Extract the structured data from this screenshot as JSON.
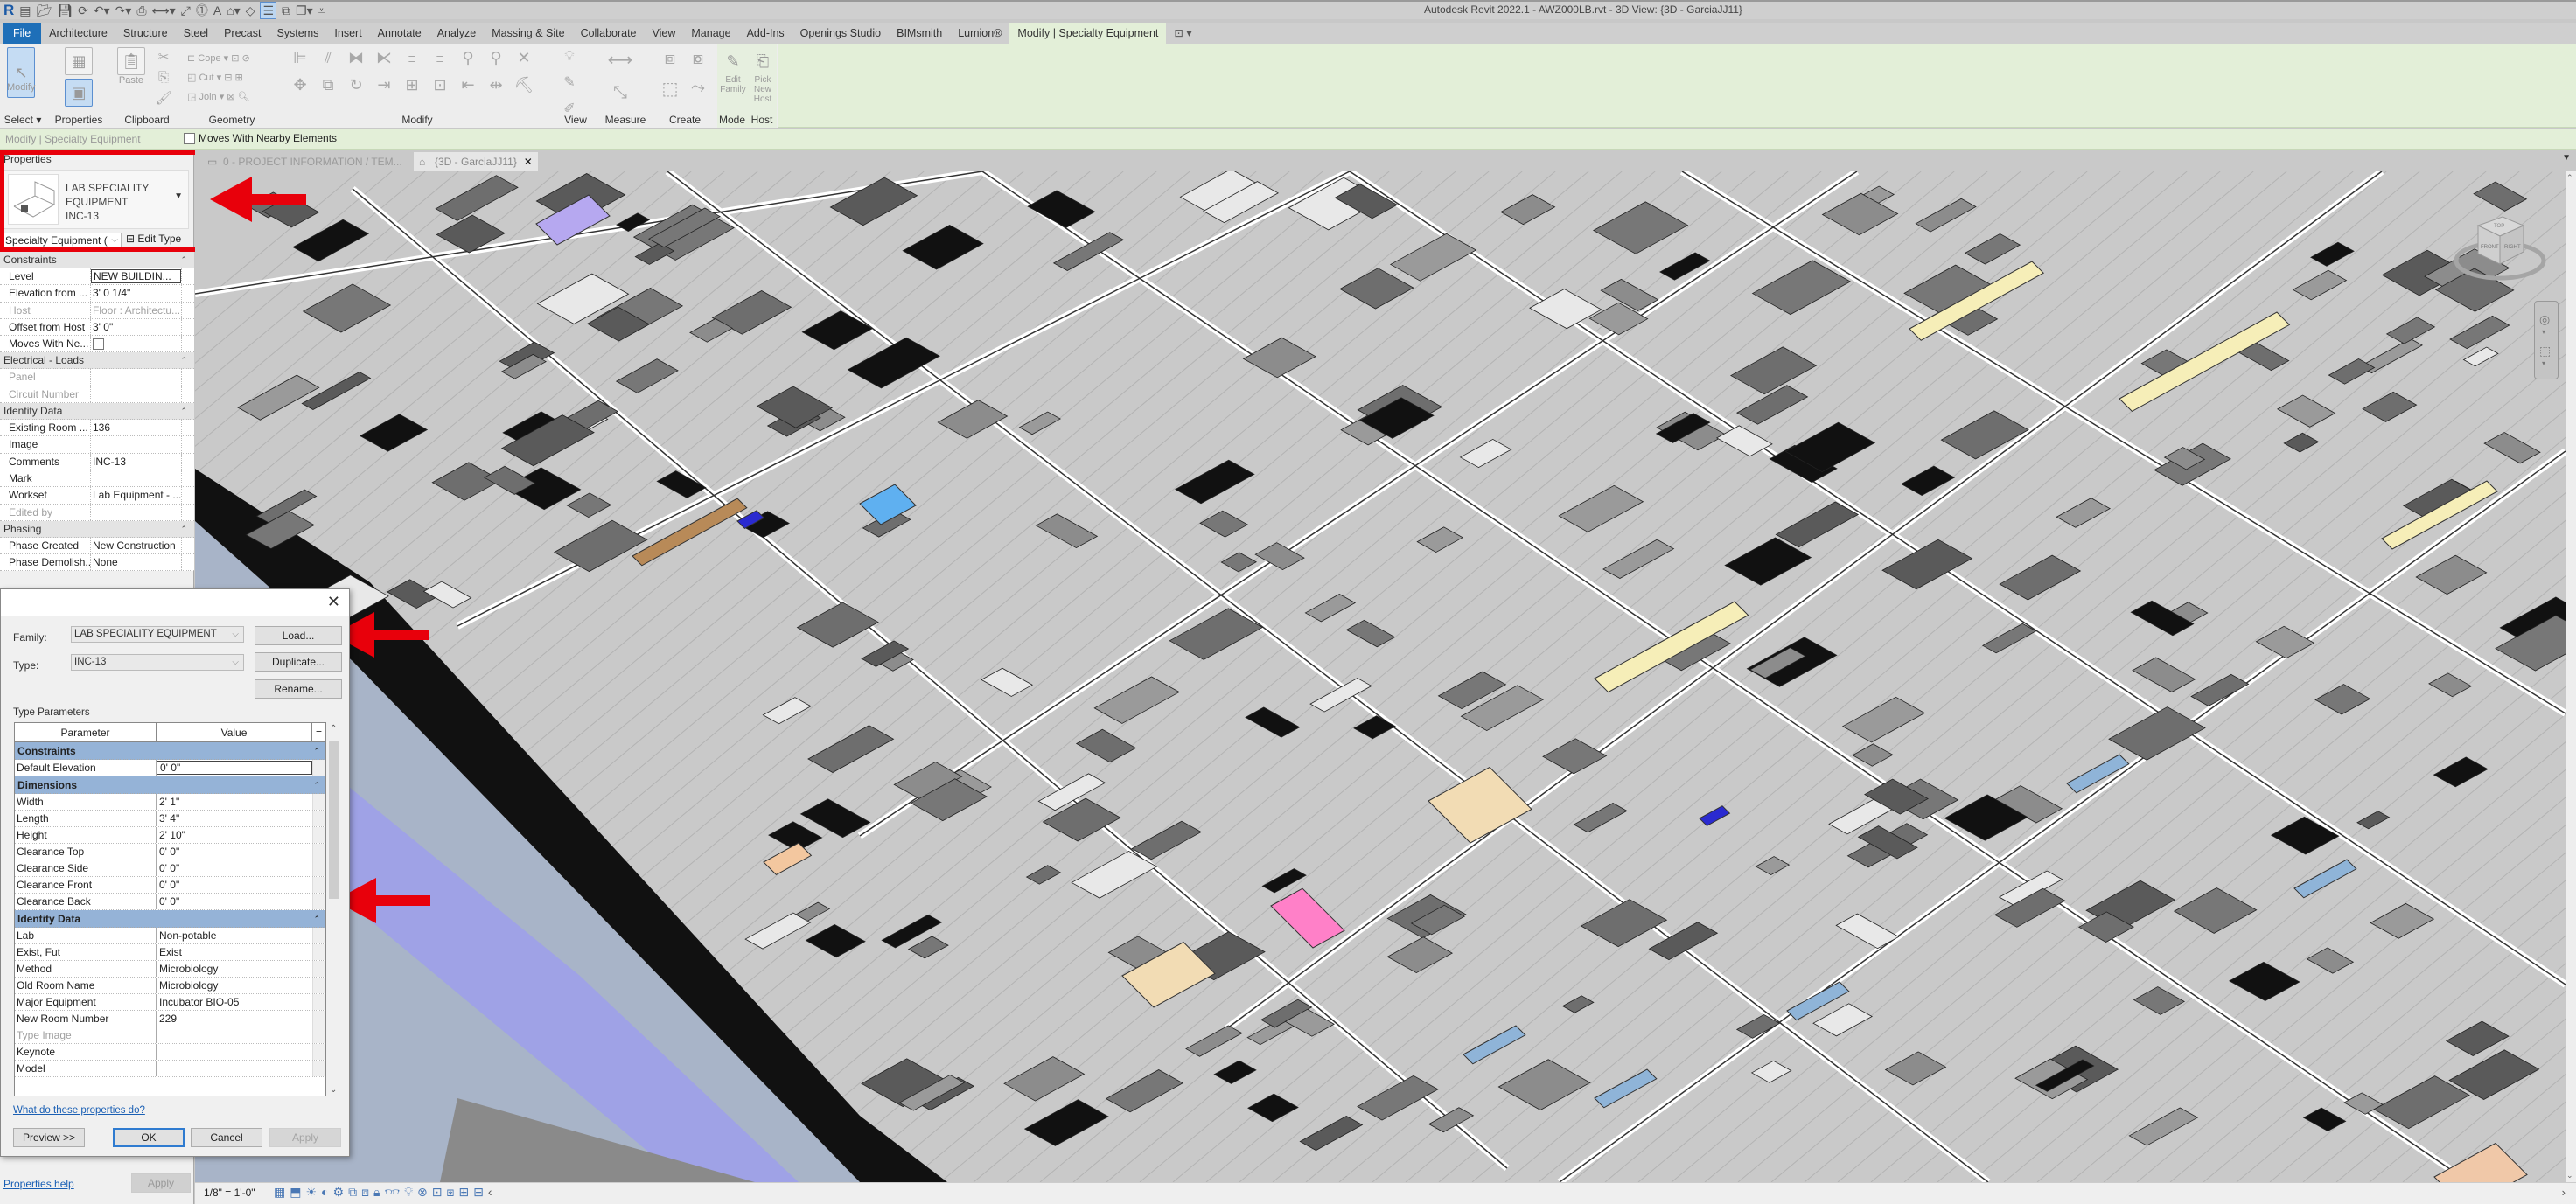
{
  "app": {
    "window_title": "Autodesk Revit 2022.1 - AWZ000LB.rvt - 3D View: {3D - GarciaJJ11}",
    "logo": "R"
  },
  "ribbon": {
    "tabs": [
      "File",
      "Architecture",
      "Structure",
      "Steel",
      "Precast",
      "Systems",
      "Insert",
      "Annotate",
      "Analyze",
      "Massing & Site",
      "Collaborate",
      "View",
      "Manage",
      "Add-Ins",
      "Openings Studio",
      "BIMsmith",
      "Lumion®",
      "Modify | Specialty Equipment"
    ],
    "active_tab": "Modify | Specialty Equipment",
    "panels": [
      "Select ▾",
      "Properties",
      "Clipboard",
      "Geometry",
      "Modify",
      "View",
      "Measure",
      "Create",
      "Mode",
      "Host"
    ],
    "buttons": {
      "modify": "Modify",
      "paste": "Paste",
      "cope": "Cope",
      "cut": "Cut",
      "join": "Join",
      "edit_family": "Edit Family",
      "pick_new_host": "Pick New Host"
    }
  },
  "options_bar": {
    "context": "Modify | Specialty Equipment",
    "moves_with_nearby": {
      "label": "Moves With Nearby Elements",
      "checked": false
    }
  },
  "properties": {
    "title": "Properties",
    "type_name_lines": [
      "LAB SPECIALITY",
      "EQUIPMENT",
      "INC-13"
    ],
    "filter": "Specialty Equipment (",
    "edit_type": "Edit Type",
    "groups": [
      {
        "name": "Constraints",
        "rows": [
          {
            "name": "Level",
            "value": "NEW BUILDIN...",
            "dim": false,
            "boxed": true
          },
          {
            "name": "Elevation from ...",
            "value": "3'  0 1/4\"",
            "dim": false
          },
          {
            "name": "Host",
            "value": "Floor : Architectu...",
            "dim": true
          },
          {
            "name": "Offset from Host",
            "value": "3'  0\"",
            "dim": false
          },
          {
            "name": "Moves With Ne...",
            "value": "",
            "checkbox": true,
            "dim": false
          }
        ]
      },
      {
        "name": "Electrical - Loads",
        "rows": [
          {
            "name": "Panel",
            "value": "",
            "dim": true
          },
          {
            "name": "Circuit Number",
            "value": "",
            "dim": true
          }
        ]
      },
      {
        "name": "Identity Data",
        "rows": [
          {
            "name": "Existing Room ...",
            "value": "136",
            "dim": false
          },
          {
            "name": "Image",
            "value": "",
            "dim": false
          },
          {
            "name": "Comments",
            "value": "INC-13",
            "dim": false
          },
          {
            "name": "Mark",
            "value": "",
            "dim": false
          },
          {
            "name": "Workset",
            "value": "Lab Equipment - ...",
            "dim": false
          },
          {
            "name": "Edited by",
            "value": "",
            "dim": true
          }
        ]
      },
      {
        "name": "Phasing",
        "rows": [
          {
            "name": "Phase Created",
            "value": "New Construction",
            "dim": false
          },
          {
            "name": "Phase Demolish...",
            "value": "None",
            "dim": false
          }
        ]
      }
    ],
    "help_link": "Properties help",
    "apply": "Apply"
  },
  "view_tabs": [
    {
      "label": "0 - PROJECT INFORMATION / TEM...",
      "active": false
    },
    {
      "label": "{3D - GarciaJJ11}",
      "active": true
    }
  ],
  "view_control": {
    "scale": "1/8\" = 1'-0\""
  },
  "viewcube": {
    "top": "TOP",
    "front": "FRONT",
    "right": "RIGHT"
  },
  "dialog": {
    "family_label": "Family:",
    "family_value": "LAB SPECIALITY EQUIPMENT",
    "type_label": "Type:",
    "type_value": "INC-13",
    "load": "Load...",
    "duplicate": "Duplicate...",
    "rename": "Rename...",
    "type_parameters_label": "Type Parameters",
    "col_parameter": "Parameter",
    "col_value": "Value",
    "col_eq": "=",
    "groups": [
      {
        "name": "Constraints",
        "rows": [
          {
            "name": "Default Elevation",
            "value": "0'  0\"",
            "boxed": true
          }
        ]
      },
      {
        "name": "Dimensions",
        "rows": [
          {
            "name": "Width",
            "value": "2'  1\""
          },
          {
            "name": "Length",
            "value": "3'  4\""
          },
          {
            "name": "Height",
            "value": "2'  10\""
          },
          {
            "name": "Clearance Top",
            "value": "0'  0\""
          },
          {
            "name": "Clearance Side",
            "value": "0'  0\""
          },
          {
            "name": "Clearance Front",
            "value": "0'  0\""
          },
          {
            "name": "Clearance Back",
            "value": "0'  0\""
          }
        ]
      },
      {
        "name": "Identity Data",
        "rows": [
          {
            "name": "Lab",
            "value": "Non-potable"
          },
          {
            "name": "Exist, Fut",
            "value": "Exist"
          },
          {
            "name": "Method",
            "value": "Microbiology"
          },
          {
            "name": "Old Room Name",
            "value": "Microbiology"
          },
          {
            "name": "Major Equipment",
            "value": "Incubator BIO-05"
          },
          {
            "name": "New Room Number",
            "value": "229"
          },
          {
            "name": "Type Image",
            "value": "",
            "dim": true
          },
          {
            "name": "Keynote",
            "value": ""
          },
          {
            "name": "Model",
            "value": ""
          }
        ]
      }
    ],
    "help_link": "What do these properties do?",
    "preview": "Preview >>",
    "ok": "OK",
    "cancel": "Cancel",
    "apply": "Apply"
  },
  "colors": {
    "ribbon_contextual": "#e3efd8",
    "file_tab": "#1e6fb8",
    "annotation_red": "#e8000b",
    "group_header_blue": "#95b3d7",
    "link_blue": "#1a5fb4"
  }
}
